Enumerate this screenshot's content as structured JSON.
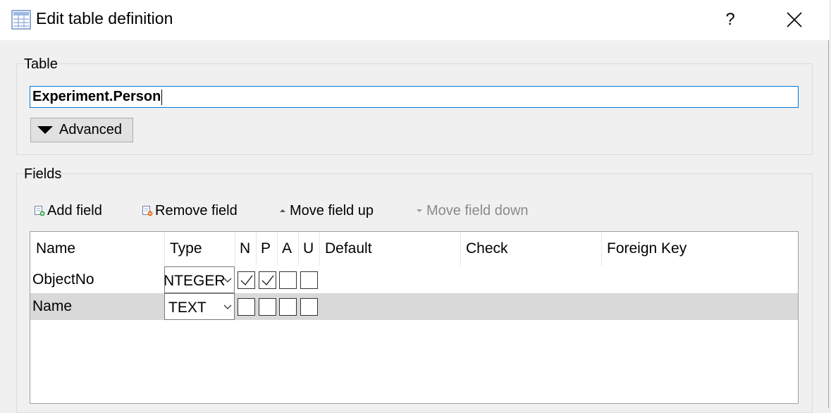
{
  "window": {
    "title": "Edit table definition",
    "help_label": "?"
  },
  "table_group": {
    "label": "Table",
    "table_name": "Experiment.Person",
    "advanced_label": "Advanced"
  },
  "fields_group": {
    "label": "Fields",
    "toolbar": {
      "add_field": "Add field",
      "remove_field": "Remove field",
      "move_up": "Move field up",
      "move_down": "Move field down"
    },
    "columns": {
      "name": "Name",
      "type": "Type",
      "n": "N",
      "p": "P",
      "a": "A",
      "u": "U",
      "default": "Default",
      "check": "Check",
      "foreign_key": "Foreign Key"
    },
    "rows": [
      {
        "name": "ObjectNo",
        "type": "NTEGER",
        "n": true,
        "p": true,
        "a": false,
        "u": false
      },
      {
        "name": "Name",
        "type": "TEXT",
        "n": false,
        "p": false,
        "a": false,
        "u": false
      }
    ]
  }
}
